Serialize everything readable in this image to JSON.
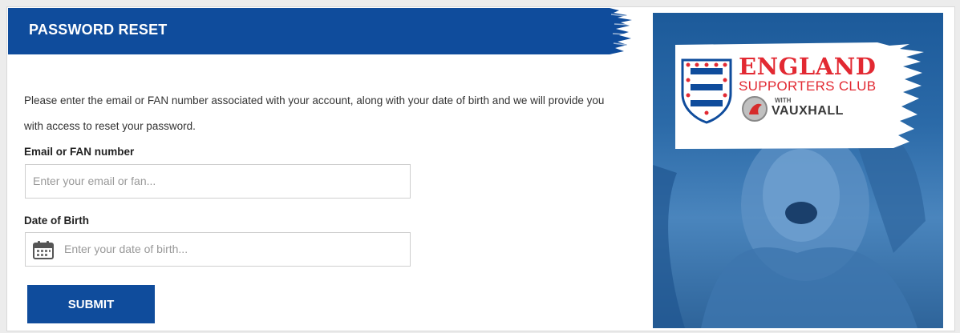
{
  "form": {
    "title": "PASSWORD RESET",
    "intro": "Please enter the email or FAN number associated with your account, along with your date of birth and we will provide you with access to reset your password.",
    "email_label": "Email or FAN number",
    "email_placeholder": "Enter your email or fan...",
    "dob_label": "Date of Birth",
    "dob_placeholder": "Enter your date of birth...",
    "submit_label": "SUBMIT"
  },
  "promo": {
    "brand_line1": "ENGLAND",
    "brand_line2": "SUPPORTERS CLUB",
    "with": "WITH",
    "sponsor": "VAUXHALL"
  },
  "colors": {
    "primary": "#0f4c9c",
    "brand_red": "#e22932"
  },
  "icons": {
    "calendar": "calendar-icon",
    "crest": "three-lions-crest-icon",
    "sponsor_logo": "vauxhall-griffin-icon"
  }
}
